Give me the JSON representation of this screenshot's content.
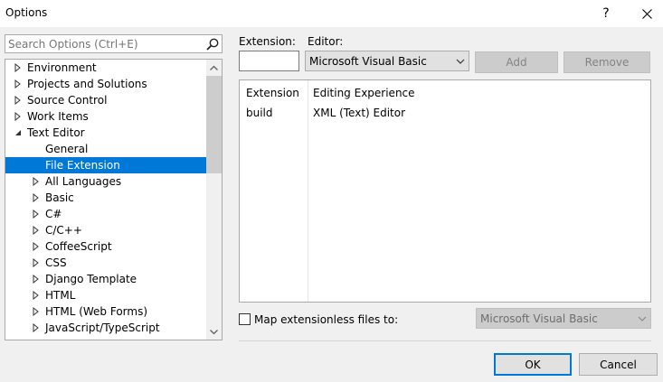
{
  "window": {
    "title": "Options",
    "help_glyph": "?",
    "close_glyph": "✕"
  },
  "search": {
    "placeholder": "Search Options (Ctrl+E)"
  },
  "tree": {
    "items": [
      {
        "label": "Environment",
        "level": 0,
        "state": "collapsed",
        "selected": false
      },
      {
        "label": "Projects and Solutions",
        "level": 0,
        "state": "collapsed",
        "selected": false
      },
      {
        "label": "Source Control",
        "level": 0,
        "state": "collapsed",
        "selected": false
      },
      {
        "label": "Work Items",
        "level": 0,
        "state": "collapsed",
        "selected": false
      },
      {
        "label": "Text Editor",
        "level": 0,
        "state": "expanded",
        "selected": false
      },
      {
        "label": "General",
        "level": 1,
        "state": "leaf",
        "selected": false
      },
      {
        "label": "File Extension",
        "level": 1,
        "state": "leaf",
        "selected": true
      },
      {
        "label": "All Languages",
        "level": 1,
        "state": "collapsed",
        "selected": false
      },
      {
        "label": "Basic",
        "level": 1,
        "state": "collapsed",
        "selected": false
      },
      {
        "label": "C#",
        "level": 1,
        "state": "collapsed",
        "selected": false
      },
      {
        "label": "C/C++",
        "level": 1,
        "state": "collapsed",
        "selected": false
      },
      {
        "label": "CoffeeScript",
        "level": 1,
        "state": "collapsed",
        "selected": false
      },
      {
        "label": "CSS",
        "level": 1,
        "state": "collapsed",
        "selected": false
      },
      {
        "label": "Django Template",
        "level": 1,
        "state": "collapsed",
        "selected": false
      },
      {
        "label": "HTML",
        "level": 1,
        "state": "collapsed",
        "selected": false
      },
      {
        "label": "HTML (Web Forms)",
        "level": 1,
        "state": "collapsed",
        "selected": false
      },
      {
        "label": "JavaScript/TypeScript",
        "level": 1,
        "state": "collapsed",
        "selected": false
      }
    ]
  },
  "extension": {
    "label": "Extension:",
    "value": ""
  },
  "editor": {
    "label": "Editor:",
    "selected": "Microsoft Visual Basic"
  },
  "buttons": {
    "add": "Add",
    "remove": "Remove",
    "ok": "OK",
    "cancel": "Cancel"
  },
  "list": {
    "columns": [
      "Extension",
      "Editing Experience"
    ],
    "rows": [
      [
        "build",
        "XML (Text) Editor"
      ]
    ]
  },
  "map_extensionless": {
    "label": "Map extensionless files to:",
    "checked": false,
    "selected": "Microsoft Visual Basic"
  },
  "colors": {
    "accent": "#0078d7",
    "selection_text": "#ffffff",
    "disabled_bg": "#cccccc",
    "disabled_text": "#838383"
  }
}
